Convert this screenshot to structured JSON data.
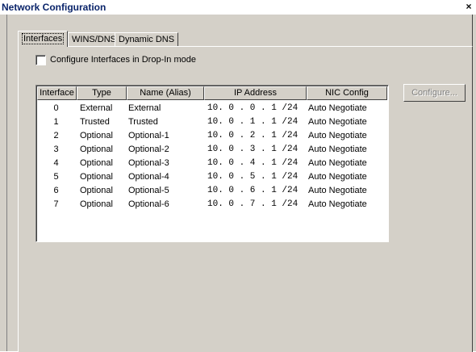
{
  "window": {
    "title": "Network Configuration",
    "close_glyph": "×"
  },
  "tabs": [
    {
      "label": "Interfaces",
      "active": true
    },
    {
      "label": "WINS/DNS",
      "active": false
    },
    {
      "label": "Dynamic DNS",
      "active": false
    }
  ],
  "dropin": {
    "label": "Configure Interfaces in Drop-In mode",
    "checked": false
  },
  "table": {
    "columns": [
      "Interface",
      "Type",
      "Name (Alias)",
      "IP Address",
      "NIC Config"
    ],
    "rows": [
      {
        "interface": "0",
        "type": "External",
        "name": "External",
        "ip": "10. 0 . 0 . 1 /24",
        "nic": "Auto Negotiate"
      },
      {
        "interface": "1",
        "type": "Trusted",
        "name": "Trusted",
        "ip": "10. 0 . 1 . 1 /24",
        "nic": "Auto Negotiate"
      },
      {
        "interface": "2",
        "type": "Optional",
        "name": "Optional-1",
        "ip": "10. 0 . 2 . 1 /24",
        "nic": "Auto Negotiate"
      },
      {
        "interface": "3",
        "type": "Optional",
        "name": "Optional-2",
        "ip": "10. 0 . 3 . 1 /24",
        "nic": "Auto Negotiate"
      },
      {
        "interface": "4",
        "type": "Optional",
        "name": "Optional-3",
        "ip": "10. 0 . 4 . 1 /24",
        "nic": "Auto Negotiate"
      },
      {
        "interface": "5",
        "type": "Optional",
        "name": "Optional-4",
        "ip": "10. 0 . 5 . 1 /24",
        "nic": "Auto Negotiate"
      },
      {
        "interface": "6",
        "type": "Optional",
        "name": "Optional-5",
        "ip": "10. 0 . 6 . 1 /24",
        "nic": "Auto Negotiate"
      },
      {
        "interface": "7",
        "type": "Optional",
        "name": "Optional-6",
        "ip": "10. 0 . 7 . 1 /24",
        "nic": "Auto Negotiate"
      }
    ]
  },
  "configure_button": {
    "label": "Configure...",
    "enabled": false
  },
  "colors": {
    "face": "#d4d0c8",
    "title_text": "#0a246a",
    "disabled_text": "#808080"
  }
}
